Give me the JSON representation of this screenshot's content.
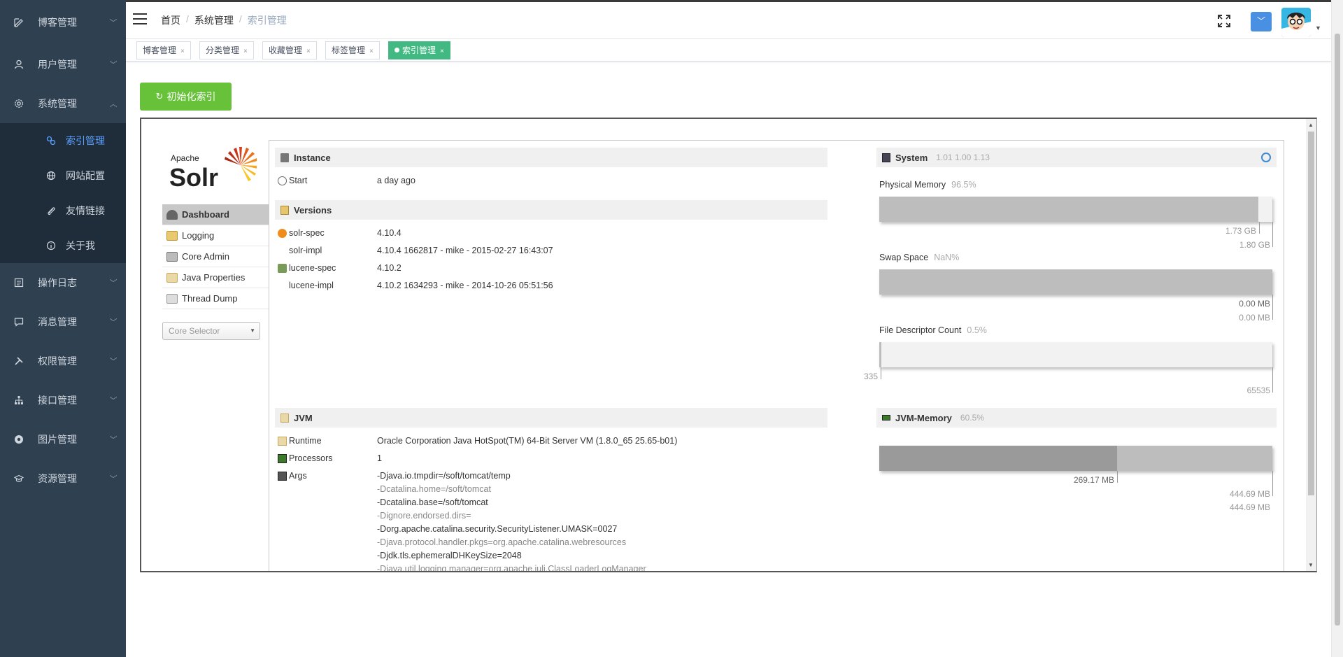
{
  "sidebar": {
    "items": [
      {
        "label": "博客管理",
        "icon": "edit-icon"
      },
      {
        "label": "用户管理",
        "icon": "user-icon"
      },
      {
        "label": "系统管理",
        "icon": "gear-icon"
      },
      {
        "label": "操作日志",
        "icon": "log-icon"
      },
      {
        "label": "消息管理",
        "icon": "message-icon"
      },
      {
        "label": "权限管理",
        "icon": "tools-icon"
      },
      {
        "label": "接口管理",
        "icon": "sitemap-icon"
      },
      {
        "label": "图片管理",
        "icon": "image-icon"
      },
      {
        "label": "资源管理",
        "icon": "graduation-icon"
      }
    ],
    "submenu": [
      {
        "label": "索引管理",
        "icon": "link-icon",
        "active": true
      },
      {
        "label": "网站配置",
        "icon": "globe-icon"
      },
      {
        "label": "友情链接",
        "icon": "paperclip-icon"
      },
      {
        "label": "关于我",
        "icon": "info-icon"
      }
    ]
  },
  "breadcrumb": {
    "home": "首页",
    "section": "系统管理",
    "current": "索引管理"
  },
  "tabs": [
    {
      "label": "博客管理"
    },
    {
      "label": "分类管理"
    },
    {
      "label": "收藏管理"
    },
    {
      "label": "标签管理"
    },
    {
      "label": "索引管理",
      "active": true
    }
  ],
  "init_button": {
    "label": "初始化索引"
  },
  "solr": {
    "logo": {
      "apache": "Apache",
      "name": "Solr"
    },
    "nav": [
      "Dashboard",
      "Logging",
      "Core Admin",
      "Java Properties",
      "Thread Dump"
    ],
    "core_selector": "Core Selector",
    "instance": {
      "title": "Instance",
      "start_label": "Start",
      "start_value": "a day ago"
    },
    "versions": {
      "title": "Versions",
      "rows": [
        {
          "k": "solr-spec",
          "v": "4.10.4"
        },
        {
          "k": "solr-impl",
          "v": "4.10.4 1662817 - mike - 2015-02-27 16:43:07"
        },
        {
          "k": "lucene-spec",
          "v": "4.10.2"
        },
        {
          "k": "lucene-impl",
          "v": "4.10.2 1634293 - mike - 2014-10-26 05:51:56"
        }
      ]
    },
    "jvm": {
      "title": "JVM",
      "runtime_label": "Runtime",
      "runtime_value": "Oracle Corporation Java HotSpot(TM) 64-Bit Server VM (1.8.0_65 25.65-b01)",
      "processors_label": "Processors",
      "processors_value": "1",
      "args_label": "Args",
      "args": [
        "-Djava.io.tmpdir=/soft/tomcat/temp",
        "-Dcatalina.home=/soft/tomcat",
        "-Dcatalina.base=/soft/tomcat",
        "-Dignore.endorsed.dirs=",
        "-Dorg.apache.catalina.security.SecurityListener.UMASK=0027",
        "-Djava.protocol.handler.pkgs=org.apache.catalina.webresources",
        "-Djdk.tls.ephemeralDHKeySize=2048",
        "-Djava.util.logging.manager=org.apache.juli.ClassLoaderLogManager"
      ]
    },
    "system": {
      "title": "System",
      "load": "1.01  1.00  1.13",
      "physical_memory": {
        "label": "Physical Memory",
        "pct": "96.5%",
        "fraction": 0.965,
        "used": "1.73 GB",
        "total": "1.80 GB"
      },
      "swap": {
        "label": "Swap Space",
        "pct": "NaN%",
        "used": "0.00 MB",
        "total": "0.00 MB"
      },
      "fd": {
        "label": "File Descriptor Count",
        "pct": "0.5%",
        "fraction": 0.005,
        "used": "335",
        "total": "65535"
      }
    },
    "jvm_memory": {
      "title": "JVM-Memory",
      "pct": "60.5%",
      "used": "269.17 MB",
      "committed": "444.69 MB",
      "max": "444.69 MB",
      "used_fraction": 0.605
    }
  }
}
